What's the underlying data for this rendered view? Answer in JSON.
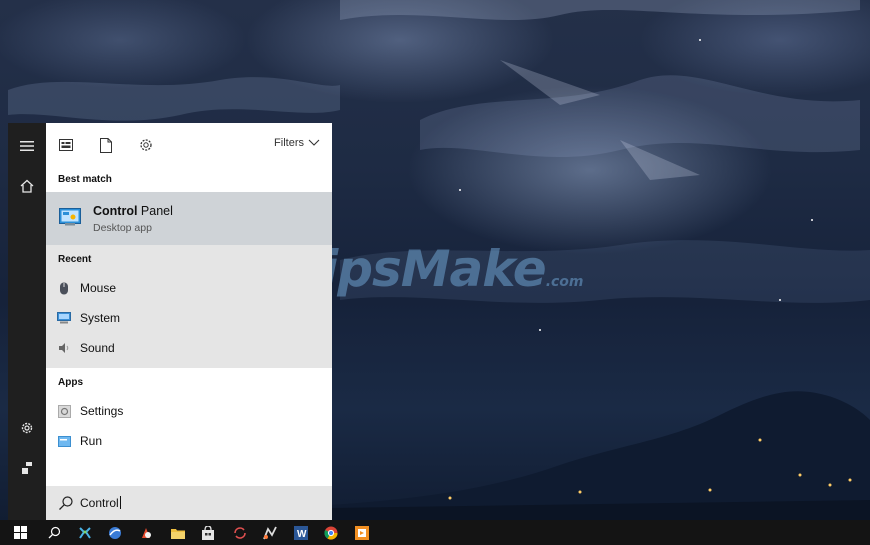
{
  "watermark": {
    "brand": "TipsMake",
    "suffix": ".com"
  },
  "start_menu": {
    "rail": {
      "items": [
        {
          "icon": "hamburger-icon"
        },
        {
          "icon": "home-icon"
        },
        {
          "icon": "gear-icon"
        },
        {
          "icon": "user-icon"
        }
      ]
    },
    "topbar": {
      "icons": [
        "apps-icon",
        "document-icon",
        "gear-icon"
      ],
      "filters_label": "Filters"
    },
    "best_match": {
      "header": "Best match",
      "item": {
        "title_bold": "Control",
        "title_rest": " Panel",
        "subtitle": "Desktop app",
        "icon": "control-panel-icon"
      }
    },
    "recent": {
      "header": "Recent",
      "items": [
        {
          "label": "Mouse",
          "icon": "mouse-icon"
        },
        {
          "label": "System",
          "icon": "system-icon"
        },
        {
          "label": "Sound",
          "icon": "speaker-icon"
        }
      ]
    },
    "apps": {
      "header": "Apps",
      "items": [
        {
          "label": "Settings",
          "icon": "settings-app-icon"
        },
        {
          "label": "Run",
          "icon": "run-icon"
        }
      ]
    },
    "search": {
      "value": "Control",
      "icon": "search-icon"
    }
  },
  "taskbar": {
    "items": [
      "windows-start-icon",
      "search-icon",
      "network-app-icon",
      "browser-icon",
      "red-app-icon",
      "file-explorer-icon",
      "store-icon",
      "sync-icon",
      "media-app-icon",
      "word-icon",
      "chrome-icon",
      "orange-app-icon"
    ]
  },
  "colors": {
    "menu_bg": "#f2f2f2",
    "rail_bg": "#1f1f1f",
    "selected_bg": "#cfd3d7",
    "taskbar_bg": "#141414"
  }
}
